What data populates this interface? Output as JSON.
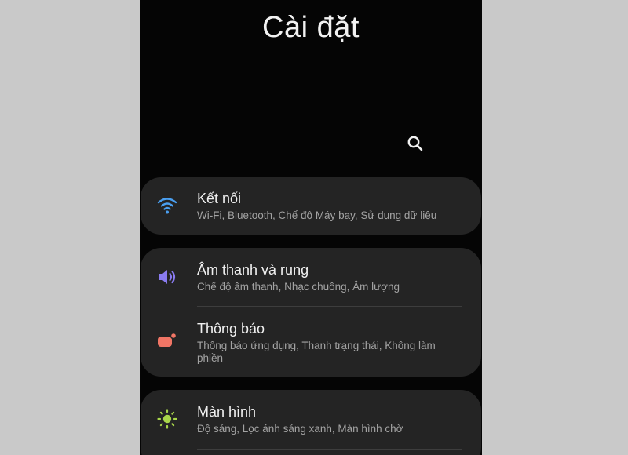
{
  "header": {
    "title": "Cài đặt",
    "search_icon": "search-icon"
  },
  "groups": [
    {
      "items": [
        {
          "title": "Kết nối",
          "subtitle": "Wi-Fi, Bluetooth, Chế độ Máy bay, Sử dụng dữ liệu",
          "icon": "wifi-icon",
          "icon_color": "#4a9ff0"
        }
      ]
    },
    {
      "items": [
        {
          "title": "Âm thanh và rung",
          "subtitle": "Chế độ âm thanh, Nhạc chuông, Âm lượng",
          "icon": "speaker-icon",
          "icon_color": "#8a7bf0"
        },
        {
          "title": "Thông báo",
          "subtitle": "Thông báo ứng dụng, Thanh trạng thái, Không làm phiền",
          "icon": "notification-icon",
          "icon_color": "#f07565"
        }
      ]
    },
    {
      "items": [
        {
          "title": "Màn hình",
          "subtitle": "Độ sáng, Lọc ánh sáng xanh, Màn hình chờ",
          "icon": "brightness-icon",
          "icon_color": "#a8d64a"
        }
      ]
    }
  ],
  "colors": {
    "background": "#050505",
    "card": "#242424",
    "title_text": "#f0f0f0",
    "subtitle_text": "#a3a3a3",
    "outer_background": "#c9c9c9"
  }
}
